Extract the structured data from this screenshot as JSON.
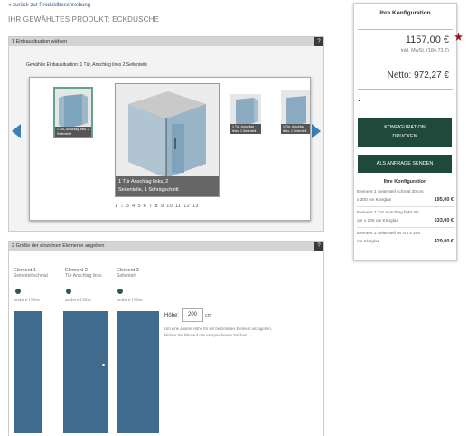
{
  "nav": {
    "back": "« zurück zur Produktbeschreibung"
  },
  "page": {
    "title": "IHR GEWÄHLTES PRODUKT: ECKDUSCHE"
  },
  "section1": {
    "title": "1 Einbausituation wählen",
    "help": "?",
    "selected_label": "Gewählte Einbausituation: 1 Tür, Anschlag links 2 Seitenteile",
    "thumbs": [
      {
        "caption": "1 Tür, Anschlag links, 2 Seitenteile"
      },
      {
        "caption": "1 Tür, Anschlag links, 1 Seitenteil"
      },
      {
        "caption": "1 Tür, Anschlag links, 1 Seitenteil"
      }
    ],
    "main_caption_line1": "1 Tür Anschlag links, 2",
    "main_caption_line2": "Seitenteile, 1 Schrägschnitt",
    "pages": [
      "1",
      "2",
      "3",
      "4",
      "5",
      "6",
      "7",
      "8",
      "9",
      "10",
      "11",
      "12",
      "13"
    ],
    "active_page": "2"
  },
  "section2": {
    "title": "2 Größe der einzelnen Elemente angeben",
    "help": "?",
    "elements": [
      {
        "name": "Element 1",
        "sub": "Seitenteil schmal",
        "height_label": "andere Höhe"
      },
      {
        "name": "Element 2",
        "sub": "Tür Anschlag links",
        "height_label": "andere Höhe"
      },
      {
        "name": "Element 3",
        "sub": "Seitenteil",
        "height_label": "andere Höhe"
      }
    ],
    "height_field_label": "Höhe:",
    "height_value": "200",
    "height_unit": "cm",
    "height_hint_line1": "Um eine andere Höhe für ein bestimmtes Element anzugeben,",
    "height_hint_line2": "klicken Sie bitte auf das entsprechende Zeichen."
  },
  "config": {
    "title": "Ihre Konfiguration",
    "price": "1157,00 €",
    "vat": "inkl. MwSt. (184,73 €)",
    "net": "Netto: 972,27 €",
    "print_line1": "KONFIGURATION",
    "print_line2": "DRUCKEN",
    "inquiry": "ALS ANFRAGE SENDEN",
    "subtitle": "Ihre Konfiguration",
    "items": [
      {
        "line1": "Element 1 Seitenteil schmal 30 cm",
        "line2": "x 200 cm Klarglas",
        "price": "195,00 €"
      },
      {
        "line1": "Element 2 Tür Anschlag links 90",
        "line2": "cm x 200 cm Klarglas",
        "price": "533,00 €"
      },
      {
        "line1": "Element 3 Seitenteil 90 cm x 200",
        "line2": "cm Klarglas",
        "price": "429,00 €"
      }
    ]
  },
  "colors": {
    "accent_green": "#1f4a3b",
    "door_blue": "#3f6b8e",
    "star_red": "#a0141e",
    "arrow_blue": "#3b7fb4"
  }
}
